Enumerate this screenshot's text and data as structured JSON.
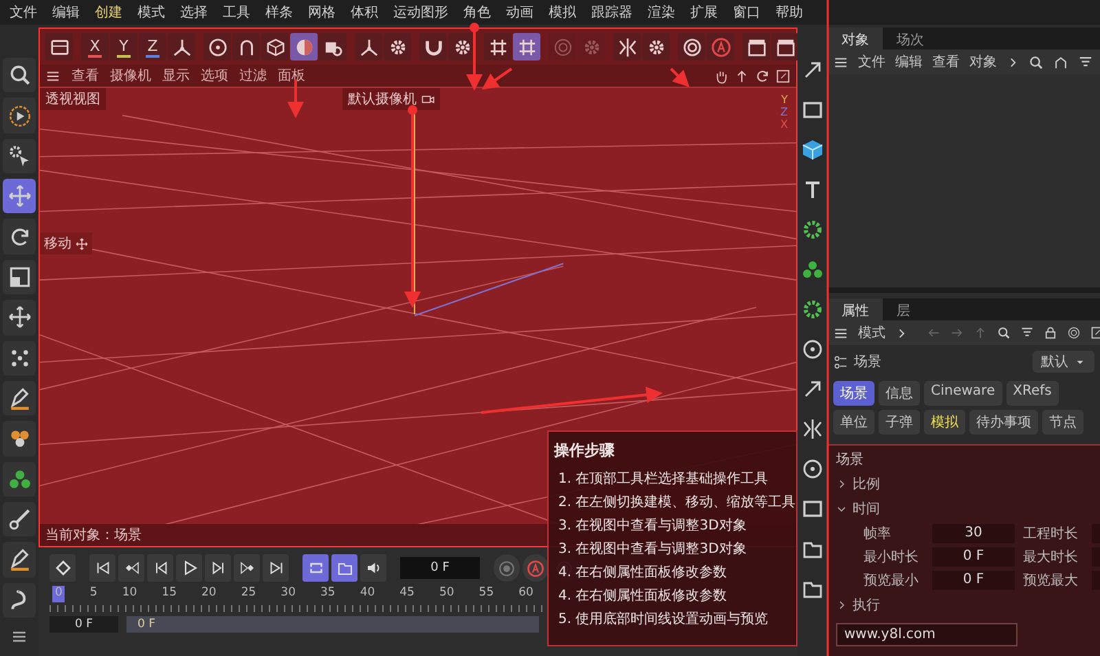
{
  "menubar": [
    {
      "label": "文件",
      "selected": false
    },
    {
      "label": "编辑",
      "selected": false
    },
    {
      "label": "创建",
      "selected": true
    },
    {
      "label": "模式",
      "selected": false
    },
    {
      "label": "选择",
      "selected": false
    },
    {
      "label": "工具",
      "selected": false
    },
    {
      "label": "样条",
      "selected": false
    },
    {
      "label": "网格",
      "selected": false
    },
    {
      "label": "体积",
      "selected": false
    },
    {
      "label": "运动图形",
      "selected": false
    },
    {
      "label": "角色",
      "selected": false
    },
    {
      "label": "动画",
      "selected": false
    },
    {
      "label": "模拟",
      "selected": false
    },
    {
      "label": "跟踪器",
      "selected": false
    },
    {
      "label": "渲染",
      "selected": false
    },
    {
      "label": "扩展",
      "selected": false
    },
    {
      "label": "窗口",
      "selected": false
    },
    {
      "label": "帮助",
      "selected": false
    }
  ],
  "main_toolbar": [
    [
      {
        "kind": "icon",
        "selected": false,
        "disabled": false
      }
    ],
    [
      {
        "kind": "axis",
        "label": "X",
        "color": "#e05555",
        "selected": false,
        "disabled": false
      },
      {
        "kind": "axis",
        "label": "Y",
        "color": "#c8c050",
        "selected": false,
        "disabled": false
      },
      {
        "kind": "axis",
        "label": "Z",
        "color": "#6080e0",
        "selected": false,
        "disabled": false
      },
      {
        "kind": "icon",
        "selected": false,
        "disabled": false
      }
    ],
    [
      {
        "kind": "icon",
        "selected": false,
        "disabled": false
      },
      {
        "kind": "icon",
        "selected": false,
        "disabled": false
      },
      {
        "kind": "icon",
        "selected": false,
        "disabled": false
      },
      {
        "kind": "icon",
        "selected": true,
        "disabled": false
      },
      {
        "kind": "icon",
        "selected": false,
        "disabled": false
      }
    ],
    [
      {
        "kind": "icon",
        "selected": false,
        "disabled": false
      },
      {
        "kind": "icon",
        "selected": false,
        "disabled": false
      }
    ],
    [
      {
        "kind": "icon",
        "selected": false,
        "disabled": false
      },
      {
        "kind": "icon",
        "selected": false,
        "disabled": false
      }
    ],
    [
      {
        "kind": "icon",
        "selected": false,
        "disabled": false
      },
      {
        "kind": "icon",
        "selected": true,
        "disabled": false
      }
    ],
    [
      {
        "kind": "icon",
        "selected": false,
        "disabled": true
      },
      {
        "kind": "icon",
        "selected": false,
        "disabled": true
      }
    ],
    [
      {
        "kind": "icon",
        "selected": false,
        "disabled": false
      },
      {
        "kind": "icon",
        "selected": false,
        "disabled": false
      }
    ],
    [
      {
        "kind": "icon",
        "selected": false,
        "disabled": false
      },
      {
        "kind": "icon",
        "selected": false,
        "disabled": false
      }
    ],
    [
      {
        "kind": "icon",
        "selected": false,
        "disabled": false
      },
      {
        "kind": "icon",
        "selected": false,
        "disabled": false
      }
    ]
  ],
  "viewport": {
    "menu": [
      "查看",
      "摄像机",
      "显示",
      "选项",
      "过滤",
      "面板"
    ],
    "view_name": "透视视图",
    "camera": "默认摄像机",
    "axis_labels": [
      "Y",
      "Z",
      "X"
    ],
    "tool_label": "移动",
    "status": "当前对象：场景"
  },
  "left_tools": [
    {
      "selected": false
    },
    {
      "selected": false
    },
    {
      "selected": false
    },
    {
      "selected": true
    },
    {
      "selected": false
    },
    {
      "selected": false
    },
    {
      "selected": false
    },
    {
      "selected": false
    },
    {
      "selected": false
    },
    {
      "selected": false
    },
    {
      "selected": false
    },
    {
      "selected": false
    },
    {
      "selected": false
    },
    {
      "selected": false
    }
  ],
  "timeline": {
    "buttons": [
      {
        "selected": false
      },
      {
        "selected": false
      },
      {
        "selected": false
      },
      {
        "selected": false
      },
      {
        "selected": false
      },
      {
        "selected": false
      },
      {
        "selected": false
      },
      {
        "selected": false
      },
      {
        "selected": true
      },
      {
        "selected": true
      },
      {
        "selected": false
      }
    ],
    "frame": "0 F",
    "ruler": [
      "0",
      "5",
      "10",
      "15",
      "20",
      "25",
      "30",
      "35",
      "40",
      "45",
      "50",
      "55",
      "60"
    ],
    "start_field": "0 F",
    "range_field": "0 F"
  },
  "object_panel": {
    "tabs": [
      {
        "label": "对象",
        "selected": true
      },
      {
        "label": "场次",
        "selected": false
      }
    ],
    "menu": [
      "文件",
      "编辑",
      "查看",
      "对象"
    ]
  },
  "attribute_panel": {
    "tabs": [
      {
        "label": "属性",
        "selected": true
      },
      {
        "label": "层",
        "selected": false
      }
    ],
    "mode": "模式",
    "title": "场景",
    "preset": "默认",
    "buttons": [
      {
        "label": "场景",
        "selected": true,
        "highlighted": false
      },
      {
        "label": "信息",
        "selected": false,
        "highlighted": false
      },
      {
        "label": "Cineware",
        "selected": false,
        "highlighted": false
      },
      {
        "label": "XRefs",
        "selected": false,
        "highlighted": false
      },
      {
        "label": "单位",
        "selected": false,
        "highlighted": false
      },
      {
        "label": "子弹",
        "selected": false,
        "highlighted": false
      },
      {
        "label": "模拟",
        "selected": false,
        "highlighted": true
      },
      {
        "label": "待办事项",
        "selected": false,
        "highlighted": false
      },
      {
        "label": "节点",
        "selected": false,
        "highlighted": false
      }
    ],
    "section": "场景",
    "groups": [
      {
        "label": "比例",
        "expanded": false
      },
      {
        "label": "时间",
        "expanded": true,
        "rows": [
          {
            "label": "帧率",
            "value": "30",
            "label_2": "工程时长"
          },
          {
            "label": "最小时长",
            "value": "0 F",
            "label_2": "最大时长"
          },
          {
            "label": "预览最小",
            "value": "0 F",
            "label_2": "预览最大"
          }
        ]
      },
      {
        "label": "执行",
        "expanded": false
      }
    ],
    "url": "www.y8l.com"
  },
  "steps": {
    "title": "操作步骤",
    "items": [
      "1. 在顶部工具栏选择基础操作工具",
      "2. 在左侧切换建模、移动、缩放等工具",
      "3. 在视图中查看与调整3D对象",
      "3. 在视图中查看与调整3D对象",
      "4. 在右侧属性面板修改参数",
      "4. 在右侧属性面板修改参数",
      "5. 使用底部时间线设置动画与预览"
    ]
  }
}
